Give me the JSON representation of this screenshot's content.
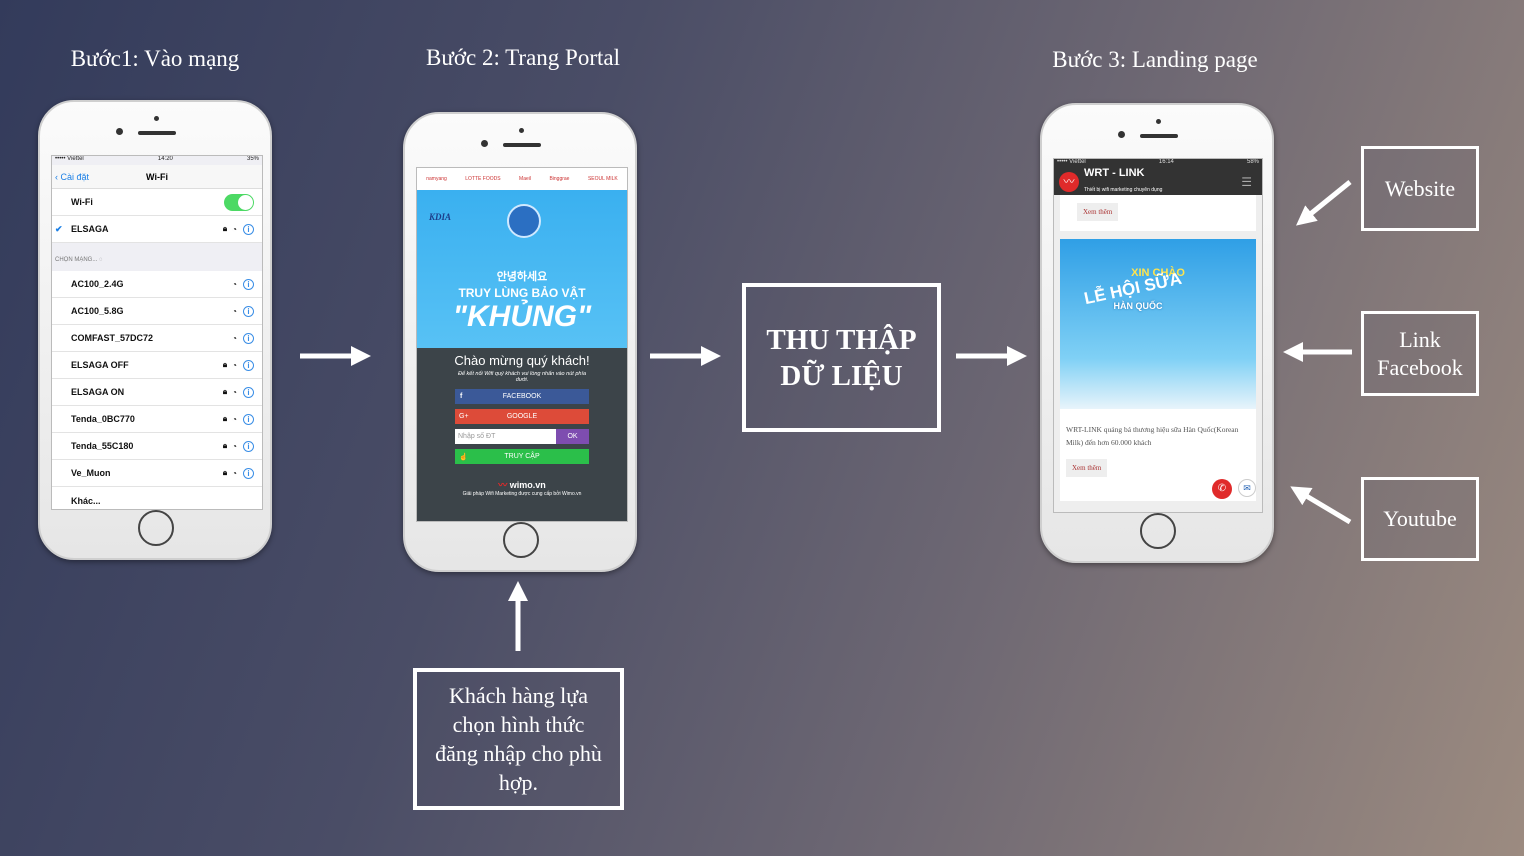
{
  "steps": {
    "s1": "Bước1: Vào mạng",
    "s2": "Bước 2: Trang Portal",
    "s3": "Bước 3: Landing page"
  },
  "phone1": {
    "carrier": "••••• Viettel",
    "time": "14:20",
    "battery": "35%",
    "back": "Cài đặt",
    "title": "Wi-Fi",
    "wifi_label": "Wi-Fi",
    "wifi_on": true,
    "connected": "ELSAGA",
    "section": "CHỌN MẠNG...",
    "networks": [
      {
        "name": "AC100_2.4G",
        "lock": false
      },
      {
        "name": "AC100_5.8G",
        "lock": false
      },
      {
        "name": "COMFAST_57DC72",
        "lock": false
      },
      {
        "name": "ELSAGA OFF",
        "lock": true
      },
      {
        "name": "ELSAGA ON",
        "lock": true
      },
      {
        "name": "Tenda_0BC770",
        "lock": true
      },
      {
        "name": "Tenda_55C180",
        "lock": true
      },
      {
        "name": "Ve_Muon",
        "lock": true
      }
    ],
    "other": "Khác..."
  },
  "phone2": {
    "sponsors": [
      "namyang",
      "LOTTE FOODS",
      "Maeil",
      "Binggrae",
      "SEOUL MILK"
    ],
    "kdia": "KDIA",
    "banner_korean": "안녕하세요",
    "banner_title": "TRUY LÙNG BẢO VẬT",
    "banner_big": "\"KHỦNG\"",
    "welcome": "Chào mừng quý khách!",
    "instruction": "Để kết nối Wifi quý khách vui lòng nhấn vào nút phía dưới.",
    "facebook": "FACEBOOK",
    "google": "GOOGLE",
    "phone_placeholder": "Nhập số ĐT",
    "ok": "OK",
    "access": "TRUY CẬP",
    "brand": "wimo.vn",
    "footer": "Giải pháp Wifi Marketing được cung cấp bởi Wimo.vn"
  },
  "phone3": {
    "carrier": "••••• Viettel",
    "time": "16:14",
    "battery": "58%",
    "brand": "WRT - LINK",
    "tagline": "Thiết bị wifi marketing chuyên dụng",
    "more1": "Xem thêm",
    "poster_title1": "XIN CHÀO",
    "poster_title2": "LỄ HỘI SỮA",
    "poster_title3": "HÀN QUỐC",
    "description": "WRT-LINK quảng bá thương hiệu sữa Hàn Quốc(Korean Milk) đến hơn 60.000 khách",
    "more2": "Xem thêm"
  },
  "center_box": {
    "line1": "THU THẬP",
    "line2": "DỮ LIỆU"
  },
  "bottom_box": "Khách hàng lựa chọn hình thức đăng nhập cho phù hợp.",
  "right_boxes": {
    "website": "Website",
    "facebook": "Link Facebook",
    "youtube": "Youtube"
  },
  "colors": {
    "facebook": "#3b5998",
    "google": "#dd4b39",
    "ok": "#7e4db0",
    "access": "#2bbf4a",
    "toggle": "#4cd964",
    "brand_red": "#e02a2a"
  }
}
